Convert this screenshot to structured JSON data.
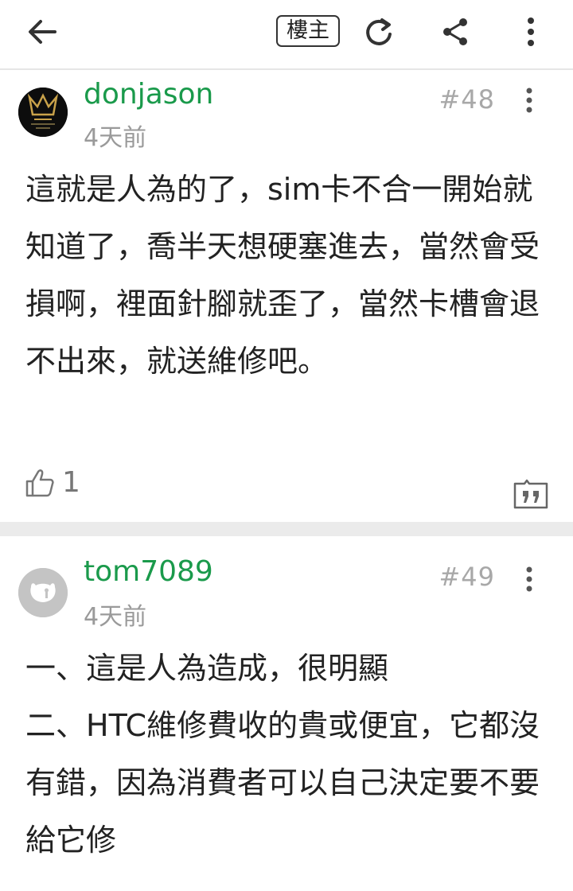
{
  "toolbar": {
    "op_badge": "樓主"
  },
  "posts": [
    {
      "username": "donjason",
      "time": "4天前",
      "floor": "#48",
      "text": "這就是人為的了，sim卡不合一開始就知道了，喬半天想硬塞進去，當然會受損啊，裡面針腳就歪了，當然卡槽會退不出來，就送維修吧。",
      "likes": "1"
    },
    {
      "username": "tom7089",
      "time": "4天前",
      "floor": "#49",
      "text": "一、這是人為造成，很明顯\n二、HTC維修費收的貴或便宜，它都沒有錯，因為消費者可以自己決定要不要給它修"
    }
  ],
  "colors": {
    "username": "#1a9a4b",
    "meta": "#9a9a9a",
    "divider": "#ebebeb"
  }
}
